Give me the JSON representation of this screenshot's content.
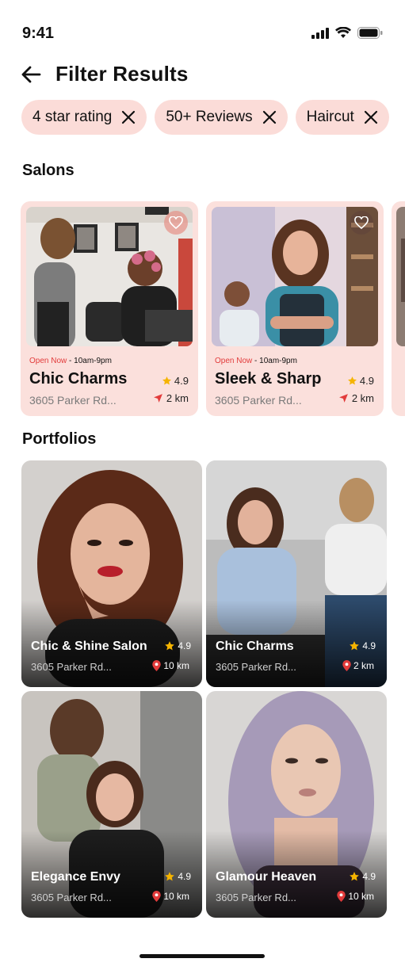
{
  "status_bar": {
    "time": "9:41"
  },
  "header": {
    "title": "Filter Results"
  },
  "chips": [
    {
      "label": "4 star rating"
    },
    {
      "label": "50+ Reviews"
    },
    {
      "label": "Haircut"
    }
  ],
  "sections": {
    "salons": "Salons",
    "portfolios": "Portfolios"
  },
  "salons": [
    {
      "open": "Open Now",
      "hours": " - 10am-9pm",
      "name": "Chic Charms",
      "rating": "4.9",
      "address": "3605 Parker Rd...",
      "distance": "2 km"
    },
    {
      "open": "Open Now",
      "hours": " - 10am-9pm",
      "name": "Sleek & Sharp",
      "rating": "4.9",
      "address": "3605 Parker Rd...",
      "distance": "2 km"
    }
  ],
  "portfolios": [
    {
      "name": "Chic & Shine Salon",
      "rating": "4.9",
      "address": "3605 Parker Rd...",
      "distance": "10 km"
    },
    {
      "name": "Chic Charms",
      "rating": "4.9",
      "address": "3605 Parker Rd...",
      "distance": "2 km"
    },
    {
      "name": "Elegance Envy",
      "rating": "4.9",
      "address": "3605 Parker Rd...",
      "distance": "10 km"
    },
    {
      "name": "Glamour Heaven",
      "rating": "4.9",
      "address": "3605 Parker Rd...",
      "distance": "10 km"
    }
  ],
  "colors": {
    "accent": "#e23b3b",
    "chip_bg": "#fbdcd8",
    "card_bg": "#fbe0dc",
    "star": "#f5b400"
  }
}
